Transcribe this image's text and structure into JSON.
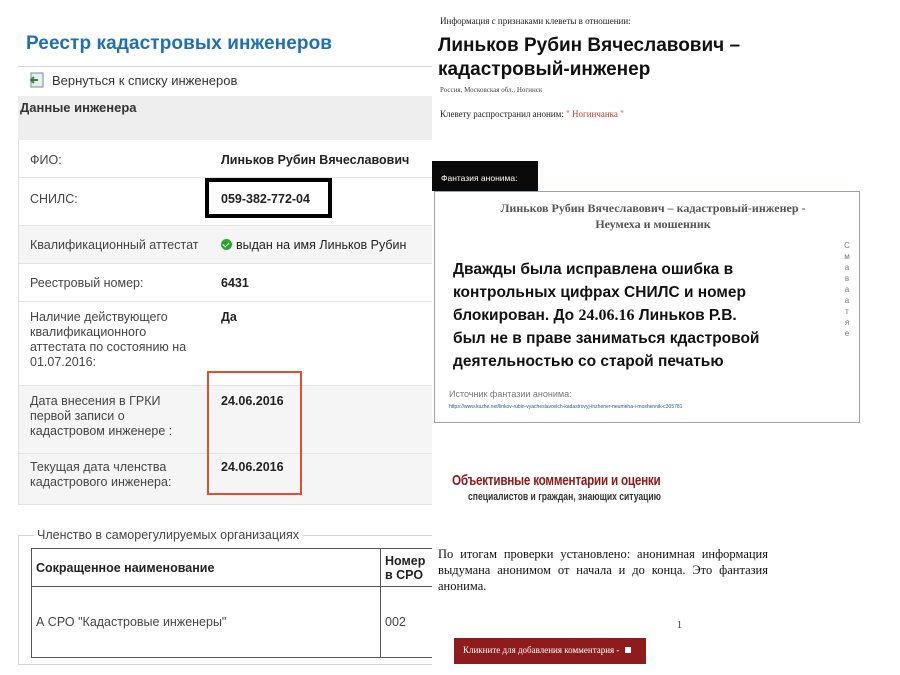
{
  "left": {
    "title": "Реестр кадастровых инженеров",
    "back_link": "Вернуться к списку инженеров",
    "section_title": "Данные инженера",
    "rows": [
      {
        "label": "ФИО:",
        "value": "Линьков Рубин Вячеславович"
      },
      {
        "label": "СНИЛС:",
        "value": "059-382-772-04"
      },
      {
        "label": "Квалификационный аттестат",
        "value": "выдан на имя Линьков Рубин"
      },
      {
        "label": "Реестровый номер:",
        "value": "6431"
      },
      {
        "label": "Наличие действующего квалификационного аттестата по состоянию на 01.07.2016:",
        "value": "Да"
      },
      {
        "label": "Дата внесения в ГРКИ первой записи о кадастровом инженере :",
        "value": "24.06.2016"
      },
      {
        "label": "Текущая дата членства кадастрового инженера:",
        "value": "24.06.2016"
      }
    ],
    "membership": {
      "legend": "Членство в саморегулируемых организациях",
      "headers": [
        "Сокращенное наименование",
        "Номер в СРО"
      ],
      "row": [
        "А СРО \"Кадастровые инженеры\"",
        "002"
      ]
    }
  },
  "right": {
    "info_line": "Информация с признаками клеветы в отношении:",
    "name_line1": "Линьков Рубин Вячеславович –",
    "name_line2": "кадастровый-инженер",
    "location": "Россия, Московская обл., Ногинск",
    "spread_label": "Клевету распространил аноним:",
    "spread_nick": "\" Ногинчанка \"",
    "fantasy_tab": "Фантазия анонима:",
    "fantasy_title": "Линьков Рубин Вячеславович – кадастровый-инженер - Неумеха и мошенник",
    "fantasy_side": "С м а в а а т я е",
    "overlay_line1": "Дважды была исправлена ошибка в",
    "overlay_line2": "контрольных цифрах СНИЛС и номер",
    "overlay_line3_a": "блокирован. До ",
    "overlay_line3_date": "24.06.16",
    "overlay_line3_b": " Линьков Р.В.",
    "overlay_line4": "был не в праве заниматься кдастровой",
    "overlay_line5": "деятельностью со старой печатью",
    "source_label": "Источник фантазии анонима:",
    "source_url": "https://www.kuzhe.net/linkov-rubin-vyacheslavovich-kadastrovyj-inzhener-neumeha-i-moshennik-c305781",
    "objective_title": "Объективные комментарии и оценки",
    "objective_sub": "специалистов и граждан, знающих ситуацию",
    "verdict": "По итогам проверки установлено: анонимная информация выдумана анонимом от начала и до конца. Это фантазия анонима.",
    "page_number": "1",
    "comment_button": "Кликните для добавления комментария -"
  }
}
